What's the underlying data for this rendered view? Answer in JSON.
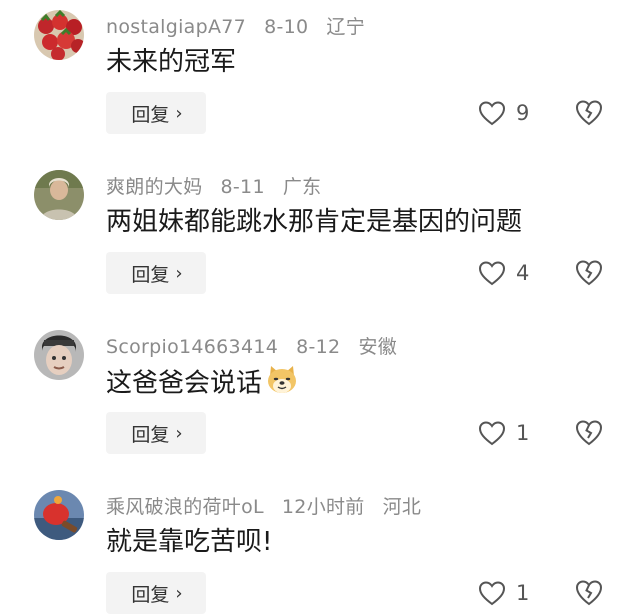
{
  "comments": [
    {
      "username": "nostalgiapA77",
      "date": "8-10",
      "location": "辽宁",
      "text": "未来的冠军",
      "reply_label": "回复",
      "likes": "9",
      "avatar_icon": "strawberries-avatar-icon"
    },
    {
      "username": "爽朗的大妈",
      "date": "8-11",
      "location": "广东",
      "text": "两姐妹都能跳水那肯定是基因的问题",
      "reply_label": "回复",
      "likes": "4",
      "avatar_icon": "person-avatar-icon"
    },
    {
      "username": "Scorpio14663414",
      "date": "8-12",
      "location": "安徽",
      "text": "这爸爸会说话",
      "emoji": "doge-emoji-icon",
      "reply_label": "回复",
      "likes": "1",
      "avatar_icon": "child-avatar-icon"
    },
    {
      "username": "乘风破浪的荷叶oL",
      "date": "12小时前",
      "location": "河北",
      "text": "就是靠吃苦呗!",
      "reply_label": "回复",
      "likes": "1",
      "avatar_icon": "ping-pong-paddle-avatar-icon"
    }
  ],
  "colors": {
    "meta_text": "#8a8a8a",
    "reply_bg": "#f3f3f3",
    "icon_stroke": "#555555"
  }
}
